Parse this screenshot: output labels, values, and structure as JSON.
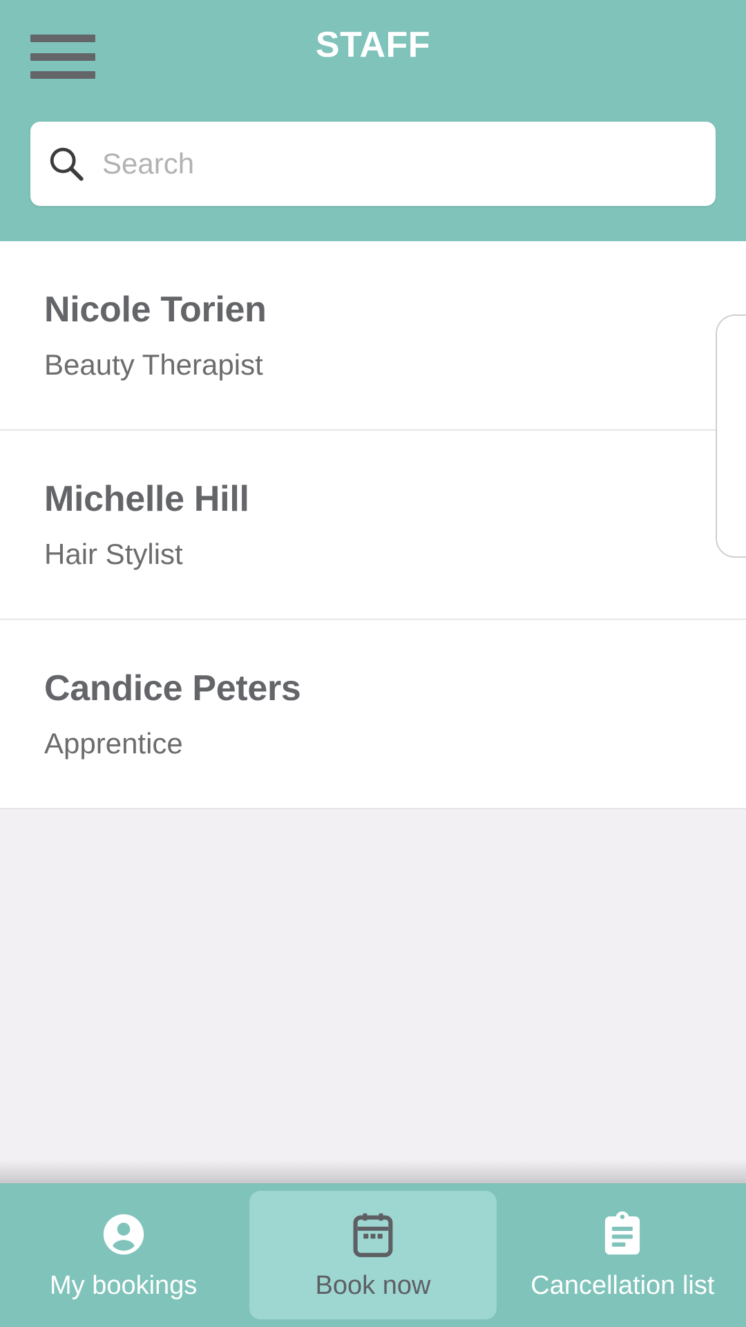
{
  "header": {
    "title": "STAFF",
    "menu_icon": "hamburger-menu-icon",
    "accent_color": "#7fc3ba"
  },
  "search": {
    "icon": "search-icon",
    "placeholder": "Search",
    "value": ""
  },
  "staff_list": [
    {
      "name": "Nicole Torien",
      "role": "Beauty Therapist"
    },
    {
      "name": "Michelle Hill",
      "role": "Hair Stylist"
    },
    {
      "name": "Candice Peters",
      "role": "Apprentice"
    }
  ],
  "bottom_nav": {
    "active_index": 1,
    "active_bg_color": "#9ed6d1",
    "bar_color": "#7fc3ba",
    "items": [
      {
        "label": "My bookings",
        "icon": "person-circle-icon",
        "active": false
      },
      {
        "label": "Book now",
        "icon": "calendar-icon",
        "active": true
      },
      {
        "label": "Cancellation list",
        "icon": "clipboard-icon",
        "active": false
      }
    ]
  },
  "scrollbar": {
    "name": "vertical-scroll-indicator"
  }
}
